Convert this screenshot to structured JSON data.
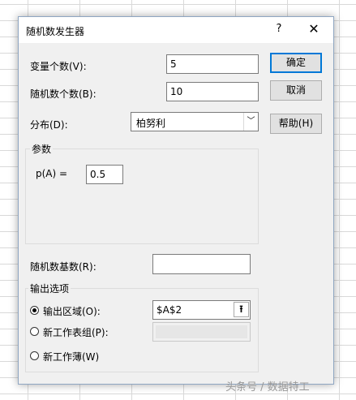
{
  "dialog": {
    "title": "随机数发生器",
    "help_glyph": "?",
    "close_glyph": "✕"
  },
  "fields": {
    "num_variables_label": "变量个数(V):",
    "num_variables_value": "5",
    "num_random_label": "随机数个数(B):",
    "num_random_value": "10",
    "distribution_label": "分布(D):",
    "distribution_value": "柏努利",
    "seed_label": "随机数基数(R):",
    "seed_value": ""
  },
  "params": {
    "group_label": "参数",
    "p_label": "p(A) =",
    "p_value": "0.5"
  },
  "output": {
    "group_label": "输出选项",
    "range_label": "输出区域(O):",
    "range_value": "$A$2",
    "range_checked": true,
    "new_sheet_label": "新工作表组(P):",
    "new_sheet_value": "",
    "new_book_label": "新工作薄(W)",
    "ref_glyph": "⭱"
  },
  "buttons": {
    "ok": "确定",
    "cancel": "取消",
    "help": "帮助(H)"
  },
  "watermark": "头条号 / 数据特工"
}
